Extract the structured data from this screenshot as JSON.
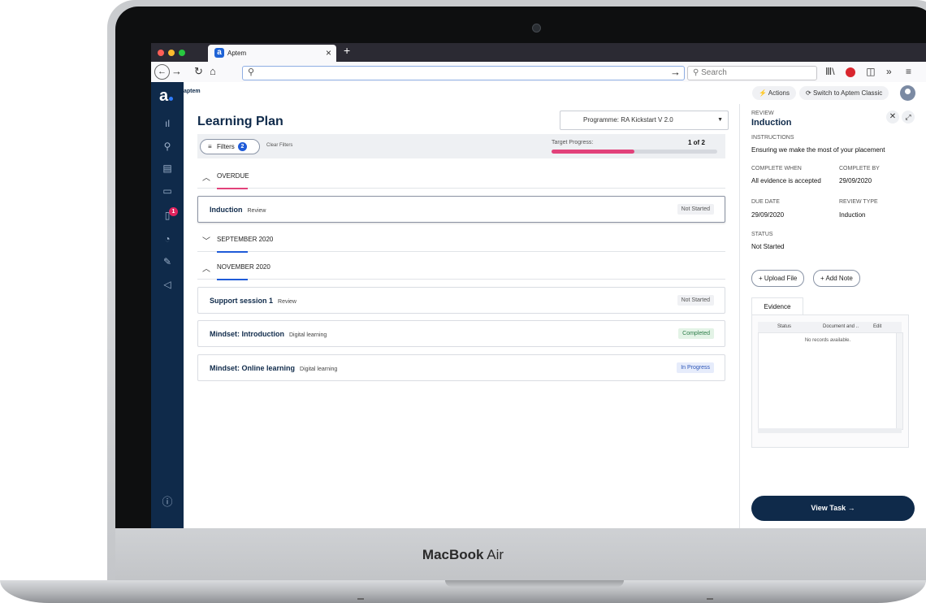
{
  "device": {
    "brand_bold": "MacBook",
    "brand_light": "Air"
  },
  "browser": {
    "tab_title": "Aptem",
    "tab_logo": "a",
    "new_tab": "+",
    "close_tab": "×",
    "search_placeholder": "Search",
    "colors": {
      "dot_red": "#ff5f57",
      "dot_yellow": "#febc2e",
      "dot_green": "#28c840"
    }
  },
  "app": {
    "logo": "a",
    "wordmark": "aptem",
    "top_actions": {
      "actions": "Actions",
      "switch": "Switch to Aptem Classic"
    },
    "nav_badge": "1",
    "colors": {
      "navy": "#0f2a4a",
      "pink": "#e2427a",
      "blue": "#1f5bd8"
    }
  },
  "main": {
    "title": "Learning Plan",
    "programme": "Programme: RA Kickstart V 2.0",
    "filters": {
      "label": "Filters",
      "count": "2",
      "clear": "Clear Filters"
    },
    "target": {
      "label": "Target Progress:",
      "value": "1 of 2",
      "fraction": 0.5
    },
    "sections": [
      {
        "label": "OVERDUE",
        "expanded": true,
        "color": "#e2427a"
      },
      {
        "label": "SEPTEMBER 2020",
        "expanded": false,
        "color": "#1f5bd8"
      },
      {
        "label": "NOVEMBER 2020",
        "expanded": true,
        "color": "#1f5bd8"
      }
    ],
    "items": [
      {
        "name": "Induction",
        "type": "Review",
        "status": "Not Started",
        "status_bg": "#f0f1f4",
        "status_fg": "#555555"
      },
      {
        "name": "Support session 1",
        "type": "Review",
        "status": "Not Started",
        "status_bg": "#f0f1f4",
        "status_fg": "#555555"
      },
      {
        "name": "Mindset: Introduction",
        "type": "Digital learning",
        "status": "Completed",
        "status_bg": "#e3f3e6",
        "status_fg": "#2e7d4a"
      },
      {
        "name": "Mindset: Online learning",
        "type": "Digital learning",
        "status": "In Progress",
        "status_bg": "#e6ecfb",
        "status_fg": "#2d56b8"
      }
    ]
  },
  "panel": {
    "kicker": "REVIEW",
    "title": "Induction",
    "instructions_label": "INSTRUCTIONS",
    "instructions": "Ensuring we make the most of your placement",
    "complete_when_label": "COMPLETE WHEN",
    "complete_when": "All evidence is accepted",
    "complete_by_label": "COMPLETE BY",
    "complete_by": "29/09/2020",
    "due_label": "DUE DATE",
    "due": "29/09/2020",
    "review_type_label": "REVIEW TYPE",
    "review_type": "Induction",
    "status_label": "STATUS",
    "status": "Not Started",
    "upload": "+ Upload File",
    "add_note": "+ Add Note",
    "evidence_tab": "Evidence",
    "cols": {
      "status": "Status",
      "document": "Document and ..",
      "edit": "Edit"
    },
    "empty": "No records available.",
    "view_task": "View Task"
  }
}
